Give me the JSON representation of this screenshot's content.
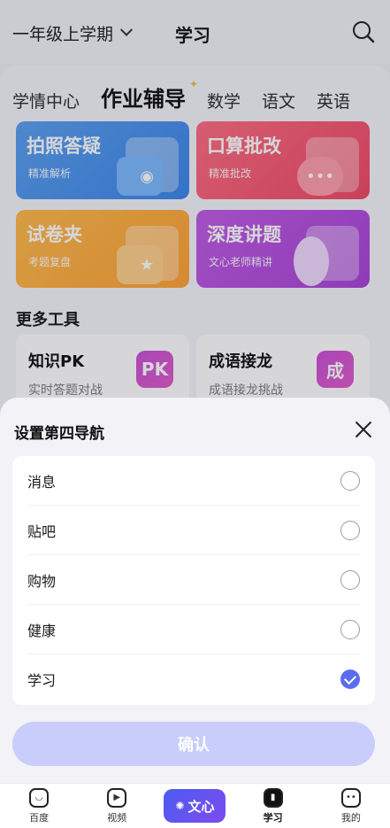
{
  "header": {
    "grade": "一年级上学期",
    "title": "学习"
  },
  "tabs": [
    "学情中心",
    "作业辅导",
    "数学",
    "语文",
    "英语"
  ],
  "cards": [
    {
      "title": "拍照答疑",
      "sub": "精准解析",
      "icon": "camera-icon"
    },
    {
      "title": "口算批改",
      "sub": "精准批改",
      "icon": "chat-bubble-icon"
    },
    {
      "title": "试卷夹",
      "sub": "考题复盘",
      "icon": "folder-star-icon"
    },
    {
      "title": "深度讲题",
      "sub": "文心老师精讲",
      "icon": "teacher-avatar-icon"
    }
  ],
  "more_tools": {
    "heading": "更多工具",
    "items": [
      {
        "title": "知识PK",
        "sub": "实时答题对战",
        "glyph": "PK"
      },
      {
        "title": "成语接龙",
        "sub": "成语接龙挑战",
        "glyph": "成"
      }
    ]
  },
  "sheet": {
    "title": "设置第四导航",
    "options": [
      {
        "label": "消息",
        "selected": false
      },
      {
        "label": "贴吧",
        "selected": false
      },
      {
        "label": "购物",
        "selected": false
      },
      {
        "label": "健康",
        "selected": false
      },
      {
        "label": "学习",
        "selected": true
      }
    ],
    "confirm_label": "确认"
  },
  "nav": {
    "items": [
      {
        "label": "百度",
        "icon": "baidu-face-icon"
      },
      {
        "label": "视频",
        "icon": "play-icon"
      },
      {
        "label": "文心",
        "icon": "wenxin-icon"
      },
      {
        "label": "学习",
        "icon": "study-icon",
        "active": true
      },
      {
        "label": "我的",
        "icon": "profile-icon"
      }
    ]
  },
  "colors": {
    "accent": "#5b6cf0",
    "confirm_disabled": "#c8cdfb"
  }
}
